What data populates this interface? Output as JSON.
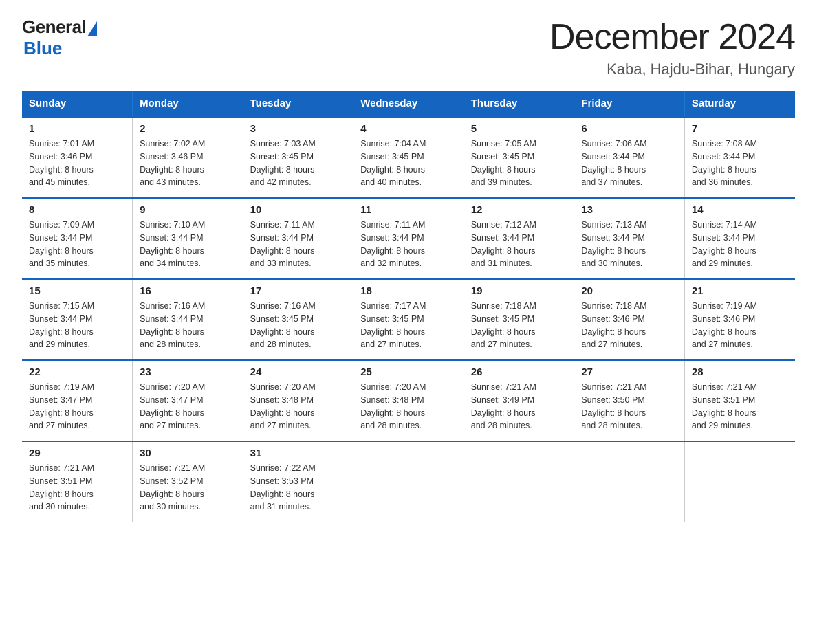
{
  "logo": {
    "general": "General",
    "blue": "Blue"
  },
  "title": "December 2024",
  "subtitle": "Kaba, Hajdu-Bihar, Hungary",
  "weekdays": [
    "Sunday",
    "Monday",
    "Tuesday",
    "Wednesday",
    "Thursday",
    "Friday",
    "Saturday"
  ],
  "weeks": [
    [
      {
        "day": "1",
        "sunrise": "Sunrise: 7:01 AM",
        "sunset": "Sunset: 3:46 PM",
        "daylight": "Daylight: 8 hours",
        "daylight2": "and 45 minutes."
      },
      {
        "day": "2",
        "sunrise": "Sunrise: 7:02 AM",
        "sunset": "Sunset: 3:46 PM",
        "daylight": "Daylight: 8 hours",
        "daylight2": "and 43 minutes."
      },
      {
        "day": "3",
        "sunrise": "Sunrise: 7:03 AM",
        "sunset": "Sunset: 3:45 PM",
        "daylight": "Daylight: 8 hours",
        "daylight2": "and 42 minutes."
      },
      {
        "day": "4",
        "sunrise": "Sunrise: 7:04 AM",
        "sunset": "Sunset: 3:45 PM",
        "daylight": "Daylight: 8 hours",
        "daylight2": "and 40 minutes."
      },
      {
        "day": "5",
        "sunrise": "Sunrise: 7:05 AM",
        "sunset": "Sunset: 3:45 PM",
        "daylight": "Daylight: 8 hours",
        "daylight2": "and 39 minutes."
      },
      {
        "day": "6",
        "sunrise": "Sunrise: 7:06 AM",
        "sunset": "Sunset: 3:44 PM",
        "daylight": "Daylight: 8 hours",
        "daylight2": "and 37 minutes."
      },
      {
        "day": "7",
        "sunrise": "Sunrise: 7:08 AM",
        "sunset": "Sunset: 3:44 PM",
        "daylight": "Daylight: 8 hours",
        "daylight2": "and 36 minutes."
      }
    ],
    [
      {
        "day": "8",
        "sunrise": "Sunrise: 7:09 AM",
        "sunset": "Sunset: 3:44 PM",
        "daylight": "Daylight: 8 hours",
        "daylight2": "and 35 minutes."
      },
      {
        "day": "9",
        "sunrise": "Sunrise: 7:10 AM",
        "sunset": "Sunset: 3:44 PM",
        "daylight": "Daylight: 8 hours",
        "daylight2": "and 34 minutes."
      },
      {
        "day": "10",
        "sunrise": "Sunrise: 7:11 AM",
        "sunset": "Sunset: 3:44 PM",
        "daylight": "Daylight: 8 hours",
        "daylight2": "and 33 minutes."
      },
      {
        "day": "11",
        "sunrise": "Sunrise: 7:11 AM",
        "sunset": "Sunset: 3:44 PM",
        "daylight": "Daylight: 8 hours",
        "daylight2": "and 32 minutes."
      },
      {
        "day": "12",
        "sunrise": "Sunrise: 7:12 AM",
        "sunset": "Sunset: 3:44 PM",
        "daylight": "Daylight: 8 hours",
        "daylight2": "and 31 minutes."
      },
      {
        "day": "13",
        "sunrise": "Sunrise: 7:13 AM",
        "sunset": "Sunset: 3:44 PM",
        "daylight": "Daylight: 8 hours",
        "daylight2": "and 30 minutes."
      },
      {
        "day": "14",
        "sunrise": "Sunrise: 7:14 AM",
        "sunset": "Sunset: 3:44 PM",
        "daylight": "Daylight: 8 hours",
        "daylight2": "and 29 minutes."
      }
    ],
    [
      {
        "day": "15",
        "sunrise": "Sunrise: 7:15 AM",
        "sunset": "Sunset: 3:44 PM",
        "daylight": "Daylight: 8 hours",
        "daylight2": "and 29 minutes."
      },
      {
        "day": "16",
        "sunrise": "Sunrise: 7:16 AM",
        "sunset": "Sunset: 3:44 PM",
        "daylight": "Daylight: 8 hours",
        "daylight2": "and 28 minutes."
      },
      {
        "day": "17",
        "sunrise": "Sunrise: 7:16 AM",
        "sunset": "Sunset: 3:45 PM",
        "daylight": "Daylight: 8 hours",
        "daylight2": "and 28 minutes."
      },
      {
        "day": "18",
        "sunrise": "Sunrise: 7:17 AM",
        "sunset": "Sunset: 3:45 PM",
        "daylight": "Daylight: 8 hours",
        "daylight2": "and 27 minutes."
      },
      {
        "day": "19",
        "sunrise": "Sunrise: 7:18 AM",
        "sunset": "Sunset: 3:45 PM",
        "daylight": "Daylight: 8 hours",
        "daylight2": "and 27 minutes."
      },
      {
        "day": "20",
        "sunrise": "Sunrise: 7:18 AM",
        "sunset": "Sunset: 3:46 PM",
        "daylight": "Daylight: 8 hours",
        "daylight2": "and 27 minutes."
      },
      {
        "day": "21",
        "sunrise": "Sunrise: 7:19 AM",
        "sunset": "Sunset: 3:46 PM",
        "daylight": "Daylight: 8 hours",
        "daylight2": "and 27 minutes."
      }
    ],
    [
      {
        "day": "22",
        "sunrise": "Sunrise: 7:19 AM",
        "sunset": "Sunset: 3:47 PM",
        "daylight": "Daylight: 8 hours",
        "daylight2": "and 27 minutes."
      },
      {
        "day": "23",
        "sunrise": "Sunrise: 7:20 AM",
        "sunset": "Sunset: 3:47 PM",
        "daylight": "Daylight: 8 hours",
        "daylight2": "and 27 minutes."
      },
      {
        "day": "24",
        "sunrise": "Sunrise: 7:20 AM",
        "sunset": "Sunset: 3:48 PM",
        "daylight": "Daylight: 8 hours",
        "daylight2": "and 27 minutes."
      },
      {
        "day": "25",
        "sunrise": "Sunrise: 7:20 AM",
        "sunset": "Sunset: 3:48 PM",
        "daylight": "Daylight: 8 hours",
        "daylight2": "and 28 minutes."
      },
      {
        "day": "26",
        "sunrise": "Sunrise: 7:21 AM",
        "sunset": "Sunset: 3:49 PM",
        "daylight": "Daylight: 8 hours",
        "daylight2": "and 28 minutes."
      },
      {
        "day": "27",
        "sunrise": "Sunrise: 7:21 AM",
        "sunset": "Sunset: 3:50 PM",
        "daylight": "Daylight: 8 hours",
        "daylight2": "and 28 minutes."
      },
      {
        "day": "28",
        "sunrise": "Sunrise: 7:21 AM",
        "sunset": "Sunset: 3:51 PM",
        "daylight": "Daylight: 8 hours",
        "daylight2": "and 29 minutes."
      }
    ],
    [
      {
        "day": "29",
        "sunrise": "Sunrise: 7:21 AM",
        "sunset": "Sunset: 3:51 PM",
        "daylight": "Daylight: 8 hours",
        "daylight2": "and 30 minutes."
      },
      {
        "day": "30",
        "sunrise": "Sunrise: 7:21 AM",
        "sunset": "Sunset: 3:52 PM",
        "daylight": "Daylight: 8 hours",
        "daylight2": "and 30 minutes."
      },
      {
        "day": "31",
        "sunrise": "Sunrise: 7:22 AM",
        "sunset": "Sunset: 3:53 PM",
        "daylight": "Daylight: 8 hours",
        "daylight2": "and 31 minutes."
      },
      {
        "day": "",
        "sunrise": "",
        "sunset": "",
        "daylight": "",
        "daylight2": ""
      },
      {
        "day": "",
        "sunrise": "",
        "sunset": "",
        "daylight": "",
        "daylight2": ""
      },
      {
        "day": "",
        "sunrise": "",
        "sunset": "",
        "daylight": "",
        "daylight2": ""
      },
      {
        "day": "",
        "sunrise": "",
        "sunset": "",
        "daylight": "",
        "daylight2": ""
      }
    ]
  ]
}
